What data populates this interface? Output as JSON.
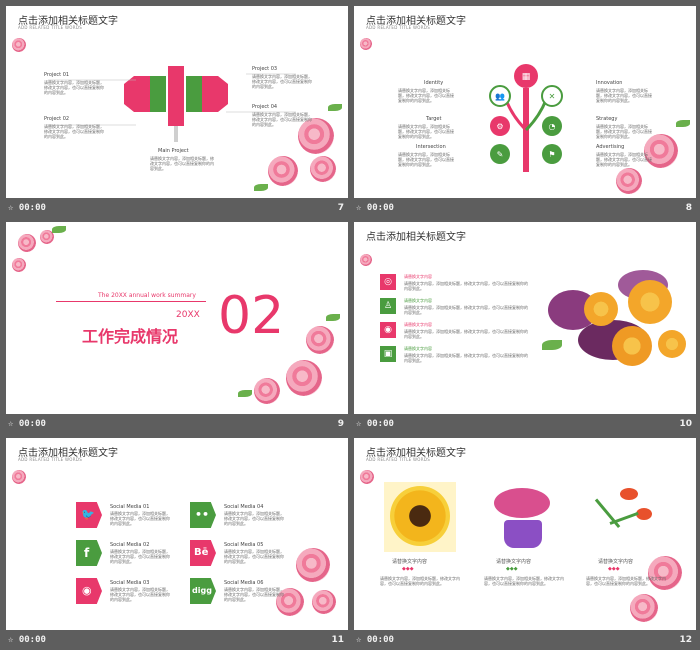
{
  "common": {
    "title": "点击添加相关标题文字",
    "subtitle": "ADD RELATED TITLE WORDS",
    "time": "00:00",
    "placeholder_text": "请替换文字内容，添加相关标题，修改文字内容，也可以直接复制你的内容到此。"
  },
  "slides": [
    {
      "number": "7",
      "projects": [
        "Project 01",
        "Project 02",
        "Project 03",
        "Project 04"
      ],
      "main": "Main  Project"
    },
    {
      "number": "8",
      "left_labels": [
        "Identity",
        "Target",
        "Intersection"
      ],
      "right_labels": [
        "Innovation",
        "Strategy",
        "Advertising"
      ]
    },
    {
      "number": "9",
      "summary": "The 20XX  annual work summary",
      "year": "20XX",
      "heading": "工作完成情况",
      "big_number": "02"
    },
    {
      "number": "10",
      "item_label": "请替换文字内容",
      "items_count_labels": [
        "请替换文字内容",
        "请替换文字内容",
        "请替换文字内容",
        "请替换文字内容"
      ]
    },
    {
      "number": "11",
      "social": [
        "Social Media 01",
        "Social Media 02",
        "Social Media 03",
        "Social Media 04",
        "Social Media 05",
        "Social Media 06"
      ],
      "social_icons": [
        "twitter-icon",
        "facebook-icon",
        "rss-icon",
        "flickr-icon",
        "behance-icon",
        "digg-icon"
      ],
      "icon_glyphs": [
        "🐦",
        "f",
        "◉",
        "••",
        "Bē",
        "digg"
      ]
    },
    {
      "number": "12",
      "captions": [
        "请替换文字内容",
        "请替换文字内容",
        "请替换文字内容"
      ]
    }
  ],
  "colors": {
    "pink": "#e8386b",
    "green": "#4a9c3f",
    "bg": "#5e5e5e"
  }
}
